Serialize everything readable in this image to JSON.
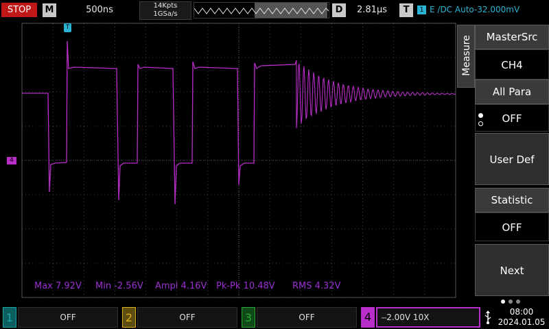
{
  "top": {
    "run_state": "STOP",
    "timebase_key": "M",
    "timebase": "500ns",
    "memory_depth": "14Kpts",
    "sample_rate": "1GSa/s",
    "delay_key": "D",
    "delay": "2.81μs",
    "trigger_key": "T",
    "trigger_channel": "1",
    "trigger_info": "E /DC Auto-32.000mV"
  },
  "measure": {
    "panel_label": "Measure",
    "master_src_label": "MasterSrc",
    "master_src_value": "CH4",
    "all_para_label": "All Para",
    "all_para_value": "OFF",
    "user_def_label": "User Def",
    "statistic_label": "Statistic",
    "statistic_value": "OFF",
    "next_label": "Next"
  },
  "measurements": {
    "max": "Max 7.92V",
    "min": "Min -2.56V",
    "ampl": "Ampl 4.16V",
    "pkpk": "Pk-Pk 10.48V",
    "rms": "RMS 4.32V"
  },
  "markers": {
    "trigger_pos": "T",
    "ch4_ref": "4"
  },
  "channels": [
    {
      "num": "1",
      "value": "OFF",
      "color": "#1aa6a6"
    },
    {
      "num": "2",
      "value": "OFF",
      "color": "#d8b020"
    },
    {
      "num": "3",
      "value": "OFF",
      "color": "#2aa83a"
    },
    {
      "num": "4",
      "value": "2.00V 10X",
      "color": "#b82ec8"
    }
  ],
  "status": {
    "time": "08:00",
    "date": "2024.01.05"
  },
  "colors": {
    "ch4": "#b82ec8",
    "trigger": "#2ab4d4",
    "measure_text": "#9a2fd0"
  }
}
